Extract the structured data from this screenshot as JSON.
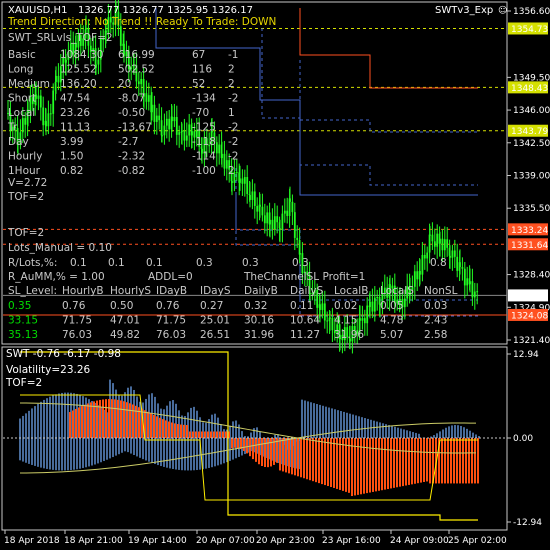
{
  "header": {
    "symbol": "XAUUSD,H1",
    "ohlc": "1326.77 1326.77 1325.95 1326.17",
    "indicator_name": "SWTv3_Exp",
    "trend_line": "Trend Direction: No Trend !!  Ready To Trade: DOWN"
  },
  "main_panel": {
    "tof_line": "SWT_SRLvls_TOF=2",
    "rows": [
      {
        "label": "Basic",
        "v1": "1084.30",
        "v2": "616.99",
        "v3": "67",
        "v4": "-1"
      },
      {
        "label": "Long",
        "v1": "125.52",
        "v2": "502.52",
        "v3": "116",
        "v4": "2"
      },
      {
        "label": "Medium",
        "v1": "136.20",
        "v2": "20",
        "v3": "52",
        "v4": "2"
      },
      {
        "label": "Short",
        "v1": "47.54",
        "v2": "-8.07",
        "v3": "-134",
        "v4": "-2"
      },
      {
        "label": "Local",
        "v1": "23.26",
        "v2": "-0.50",
        "v3": "-70",
        "v4": "1"
      },
      {
        "label": "Tr",
        "v1": "11.13",
        "v2": "-13.67",
        "v3": "-125",
        "v4": "-2"
      },
      {
        "label": "Day",
        "v1": "3.99",
        "v2": "-2.7",
        "v3": "-118",
        "v4": "-2"
      },
      {
        "label": "Hourly",
        "v1": "1.50",
        "v2": "-2.32",
        "v3": "-114",
        "v4": "-2"
      },
      {
        "label": "1Hour",
        "v1": "0.82",
        "v2": "-0.82",
        "v3": "-100",
        "v4": "2"
      }
    ],
    "v_line": "V=2.72",
    "tof_line2": "TOF=2",
    "tof_line3": "TOF=2",
    "lots_manual": "Lots_Manual = 0.10",
    "r_lots_label": "R/Lots,%:",
    "r_lots_values": [
      "0.1",
      "0.1",
      "0.1",
      "0.3",
      "0.3",
      "0.3",
      "0.8"
    ],
    "r_aumm": "R_AuMM,% = 1.00",
    "addl": "ADDL=0",
    "channel_profit": "TheChannelSL Profit=1",
    "sl_headers": [
      "SL_Level:",
      "HourlyB",
      "HourlyS",
      "IDayB",
      "IDayS",
      "DailyB",
      "DailyS",
      "LocalB",
      "LocalS",
      "NonSL"
    ],
    "sl_rows": [
      {
        "color": "#00dd00",
        "values": [
          "0.35",
          "0.76",
          "0.50",
          "0.76",
          "0.27",
          "0.32",
          "0.11",
          "0.02",
          "0.05",
          "0.03"
        ]
      },
      {
        "color": "#00dd00",
        "values": [
          "33.15",
          "71.75",
          "47.01",
          "71.75",
          "25.01",
          "30.16",
          "10.64",
          "4.15",
          "4.78",
          "2.43"
        ]
      },
      {
        "color": "#00dd00",
        "values": [
          "35.13",
          "76.03",
          "49.82",
          "76.03",
          "26.51",
          "31.96",
          "11.27",
          "31.96",
          "5.07",
          "2.58"
        ]
      }
    ]
  },
  "price_axis": {
    "labels": [
      "1356.60",
      "1349.50",
      "1346.00",
      "1342.50",
      "1339.00",
      "1335.50",
      "1328.40",
      "1324.90",
      "1321.40"
    ],
    "tags": [
      {
        "value": "1354.73",
        "bg": "#d4e000",
        "fg": "#000"
      },
      {
        "value": "1348.43",
        "bg": "#d4e000",
        "fg": "#000"
      },
      {
        "value": "1343.79",
        "bg": "#d4e000",
        "fg": "#000"
      },
      {
        "value": "1333.24",
        "bg": "#ff5020",
        "fg": "#000"
      },
      {
        "value": "1331.64",
        "bg": "#ff5020",
        "fg": "#000"
      },
      {
        "value": "1326.17",
        "bg": "#ffffff",
        "fg": "#000"
      },
      {
        "value": "1324.08",
        "bg": "#ff5020",
        "fg": "#000"
      }
    ]
  },
  "sub_panel": {
    "title": "SWT -0.76 -6.17 -0.98",
    "volatility": "Volatility=23.26",
    "tof": "TOF=2",
    "axis_labels": [
      "12.94",
      "0.00",
      "-12.94"
    ]
  },
  "time_axis": {
    "labels": [
      "18 Apr 2018",
      "18 Apr 21:00",
      "19 Apr 14:00",
      "20 Apr 07:00",
      "20 Apr 23:00",
      "23 Apr 16:00",
      "24 Apr 09:00",
      "25 Apr 02:00"
    ]
  }
}
